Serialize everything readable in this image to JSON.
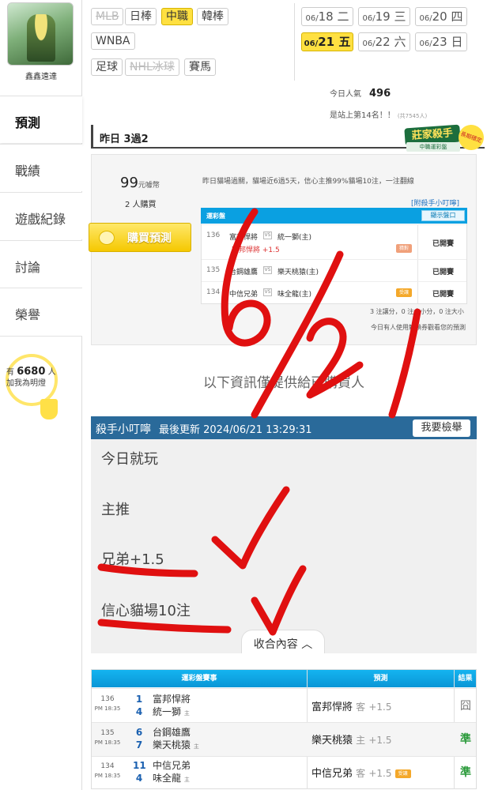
{
  "user": {
    "name": "鑫鑫遠達"
  },
  "nav": [
    {
      "label": "預測",
      "active": true
    },
    {
      "label": "戰績"
    },
    {
      "label": "遊戲紀錄"
    },
    {
      "label": "討論"
    },
    {
      "label": "榮譽"
    }
  ],
  "lamp": {
    "prefix": "有",
    "count": "6680",
    "suffix": "人",
    "caption": "加我為明燈"
  },
  "leagues": [
    {
      "label": "MLB",
      "state": "disabled"
    },
    {
      "label": "日棒"
    },
    {
      "label": "中職",
      "state": "selected"
    },
    {
      "label": "韓棒"
    },
    {
      "label": "WNBA"
    },
    {
      "label": "足球"
    },
    {
      "label": "NHL冰球",
      "state": "disabled"
    },
    {
      "label": "賽馬"
    }
  ],
  "dates": [
    {
      "month": "06/",
      "day": "18",
      "dow": "二"
    },
    {
      "month": "06/",
      "day": "19",
      "dow": "三"
    },
    {
      "month": "06/",
      "day": "20",
      "dow": "四"
    },
    {
      "month": "06/",
      "day": "21",
      "dow": "五",
      "selected": true
    },
    {
      "month": "06/",
      "day": "22",
      "dow": "六"
    },
    {
      "month": "06/",
      "day": "23",
      "dow": "日"
    }
  ],
  "popularity": {
    "label": "今日人氣",
    "value": "496"
  },
  "rank": {
    "text": "是站上第14名！！",
    "note": "(共7545人)"
  },
  "yesterday": {
    "title": "昨日 3過2"
  },
  "badge": {
    "line1": "莊家殺手",
    "line2": "中職運彩盤",
    "seal": "長期穩定"
  },
  "offer": {
    "price": "99",
    "currency": "元噱幣",
    "buyers": "2 人購買",
    "buy_label": "購買預測",
    "description": "昨日貓場過關，貓場近6過5天，信心主推99%貓場10注，一注翻線",
    "link": "[附殺手小叮嚀]"
  },
  "preview": {
    "header": "運彩盤",
    "show_button": "顯示盤口",
    "rows": [
      {
        "no": "136",
        "team1": "富邦悍將",
        "team2": "統一獅(主)",
        "pick": "富邦悍將 +1.5",
        "tag": "猜對",
        "result": "已開賽"
      },
      {
        "no": "135",
        "team1": "台鋼雄鷹",
        "team2": "樂天桃猿(主)",
        "result": "已開賽"
      },
      {
        "no": "134",
        "team1": "中信兄弟",
        "team2": "味全龍(主)",
        "tag": "受讓",
        "result": "已開賽"
      }
    ],
    "vs": "VS",
    "stats": "3 注讓分，0 注大小分，0 注大小",
    "unlock": "今日有人使用解鎖券觀看您的預測"
  },
  "notice": "以下資訊僅提供給已購買人",
  "tips": {
    "title": "殺手小叮嚀",
    "updated": "最後更新 2024/06/21 13:29:31",
    "report": "我要檢舉",
    "lines": [
      "今日就玩",
      "主推",
      "兄弟+1.5",
      "信心貓場10注"
    ],
    "collapse": "收合內容"
  },
  "results": {
    "headers": [
      "運彩盤賽事",
      "預測",
      "結果"
    ],
    "rows": [
      {
        "no": "136",
        "time": "PM 18:35",
        "s1": "1",
        "s2": "4",
        "team1": "富邦悍將",
        "team2": "統一獅",
        "home": "主",
        "pick": "富邦悍將",
        "side": "客",
        "line": "+1.5",
        "result": "囧",
        "win": false
      },
      {
        "no": "135",
        "time": "PM 18:35",
        "s1": "6",
        "s2": "7",
        "team1": "台鋼雄鷹",
        "team2": "樂天桃猿",
        "home": "主",
        "pick": "樂天桃猿",
        "side": "主",
        "line": "+1.5",
        "result": "準",
        "win": true
      },
      {
        "no": "134",
        "time": "PM 18:35",
        "s1": "11",
        "s2": "4",
        "team1": "中信兄弟",
        "team2": "味全龍",
        "home": "主",
        "pick": "中信兄弟",
        "side": "客",
        "line": "+1.5",
        "tag": "受讓",
        "result": "準",
        "win": true
      }
    ]
  },
  "annotation": {
    "handwriting": "6/21",
    "color": "#e01010"
  },
  "colors": {
    "accent": "#ffe041",
    "header_blue": "#0aa0e1",
    "tips_head": "#2a6a9a",
    "win": "#2a9a3a"
  }
}
